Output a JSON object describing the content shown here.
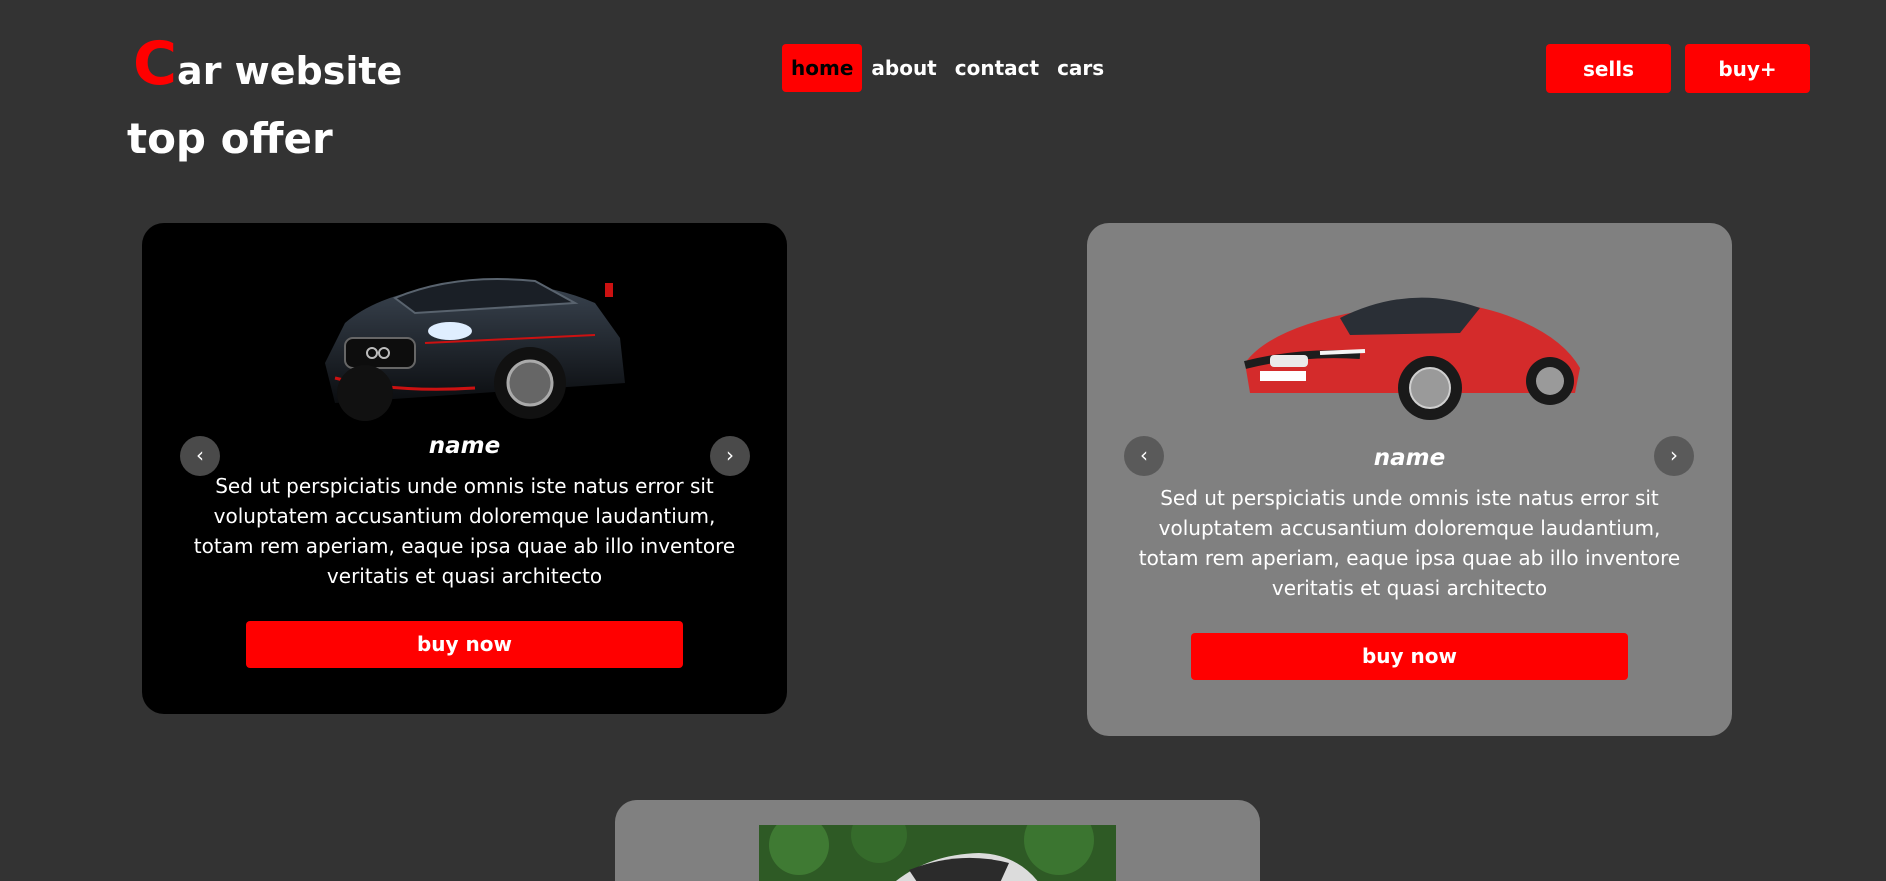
{
  "header": {
    "logo_initial": "C",
    "logo_rest": "ar website",
    "nav": [
      {
        "label": "home",
        "active": true
      },
      {
        "label": "about",
        "active": false
      },
      {
        "label": "contact",
        "active": false
      },
      {
        "label": "cars",
        "active": false
      }
    ],
    "actions": {
      "sells": "sells",
      "buy": "buy+"
    }
  },
  "section": {
    "title": "top offer"
  },
  "cards": [
    {
      "name": "name",
      "description_line1": "Sed ut perspiciatis unde omnis iste natus error sit voluptatem accusantium doloremque laudantium,",
      "description_line2": "totam rem aperiam, eaque ipsa quae ab illo inventore veritatis et quasi architecto",
      "button": "buy now",
      "prev_icon": "chevron-left-icon",
      "next_icon": "chevron-right-icon"
    },
    {
      "name": "name",
      "description_line1": "Sed ut perspiciatis unde omnis iste natus error sit voluptatem accusantium doloremque laudantium,",
      "description_line2": "totam rem aperiam, eaque ipsa quae ab illo inventore veritatis et quasi architecto",
      "button": "buy now",
      "prev_icon": "chevron-left-icon",
      "next_icon": "chevron-right-icon"
    }
  ],
  "colors": {
    "background": "#333333",
    "accent": "#ff0000",
    "card_dark": "#000000",
    "card_gray": "#808080"
  }
}
